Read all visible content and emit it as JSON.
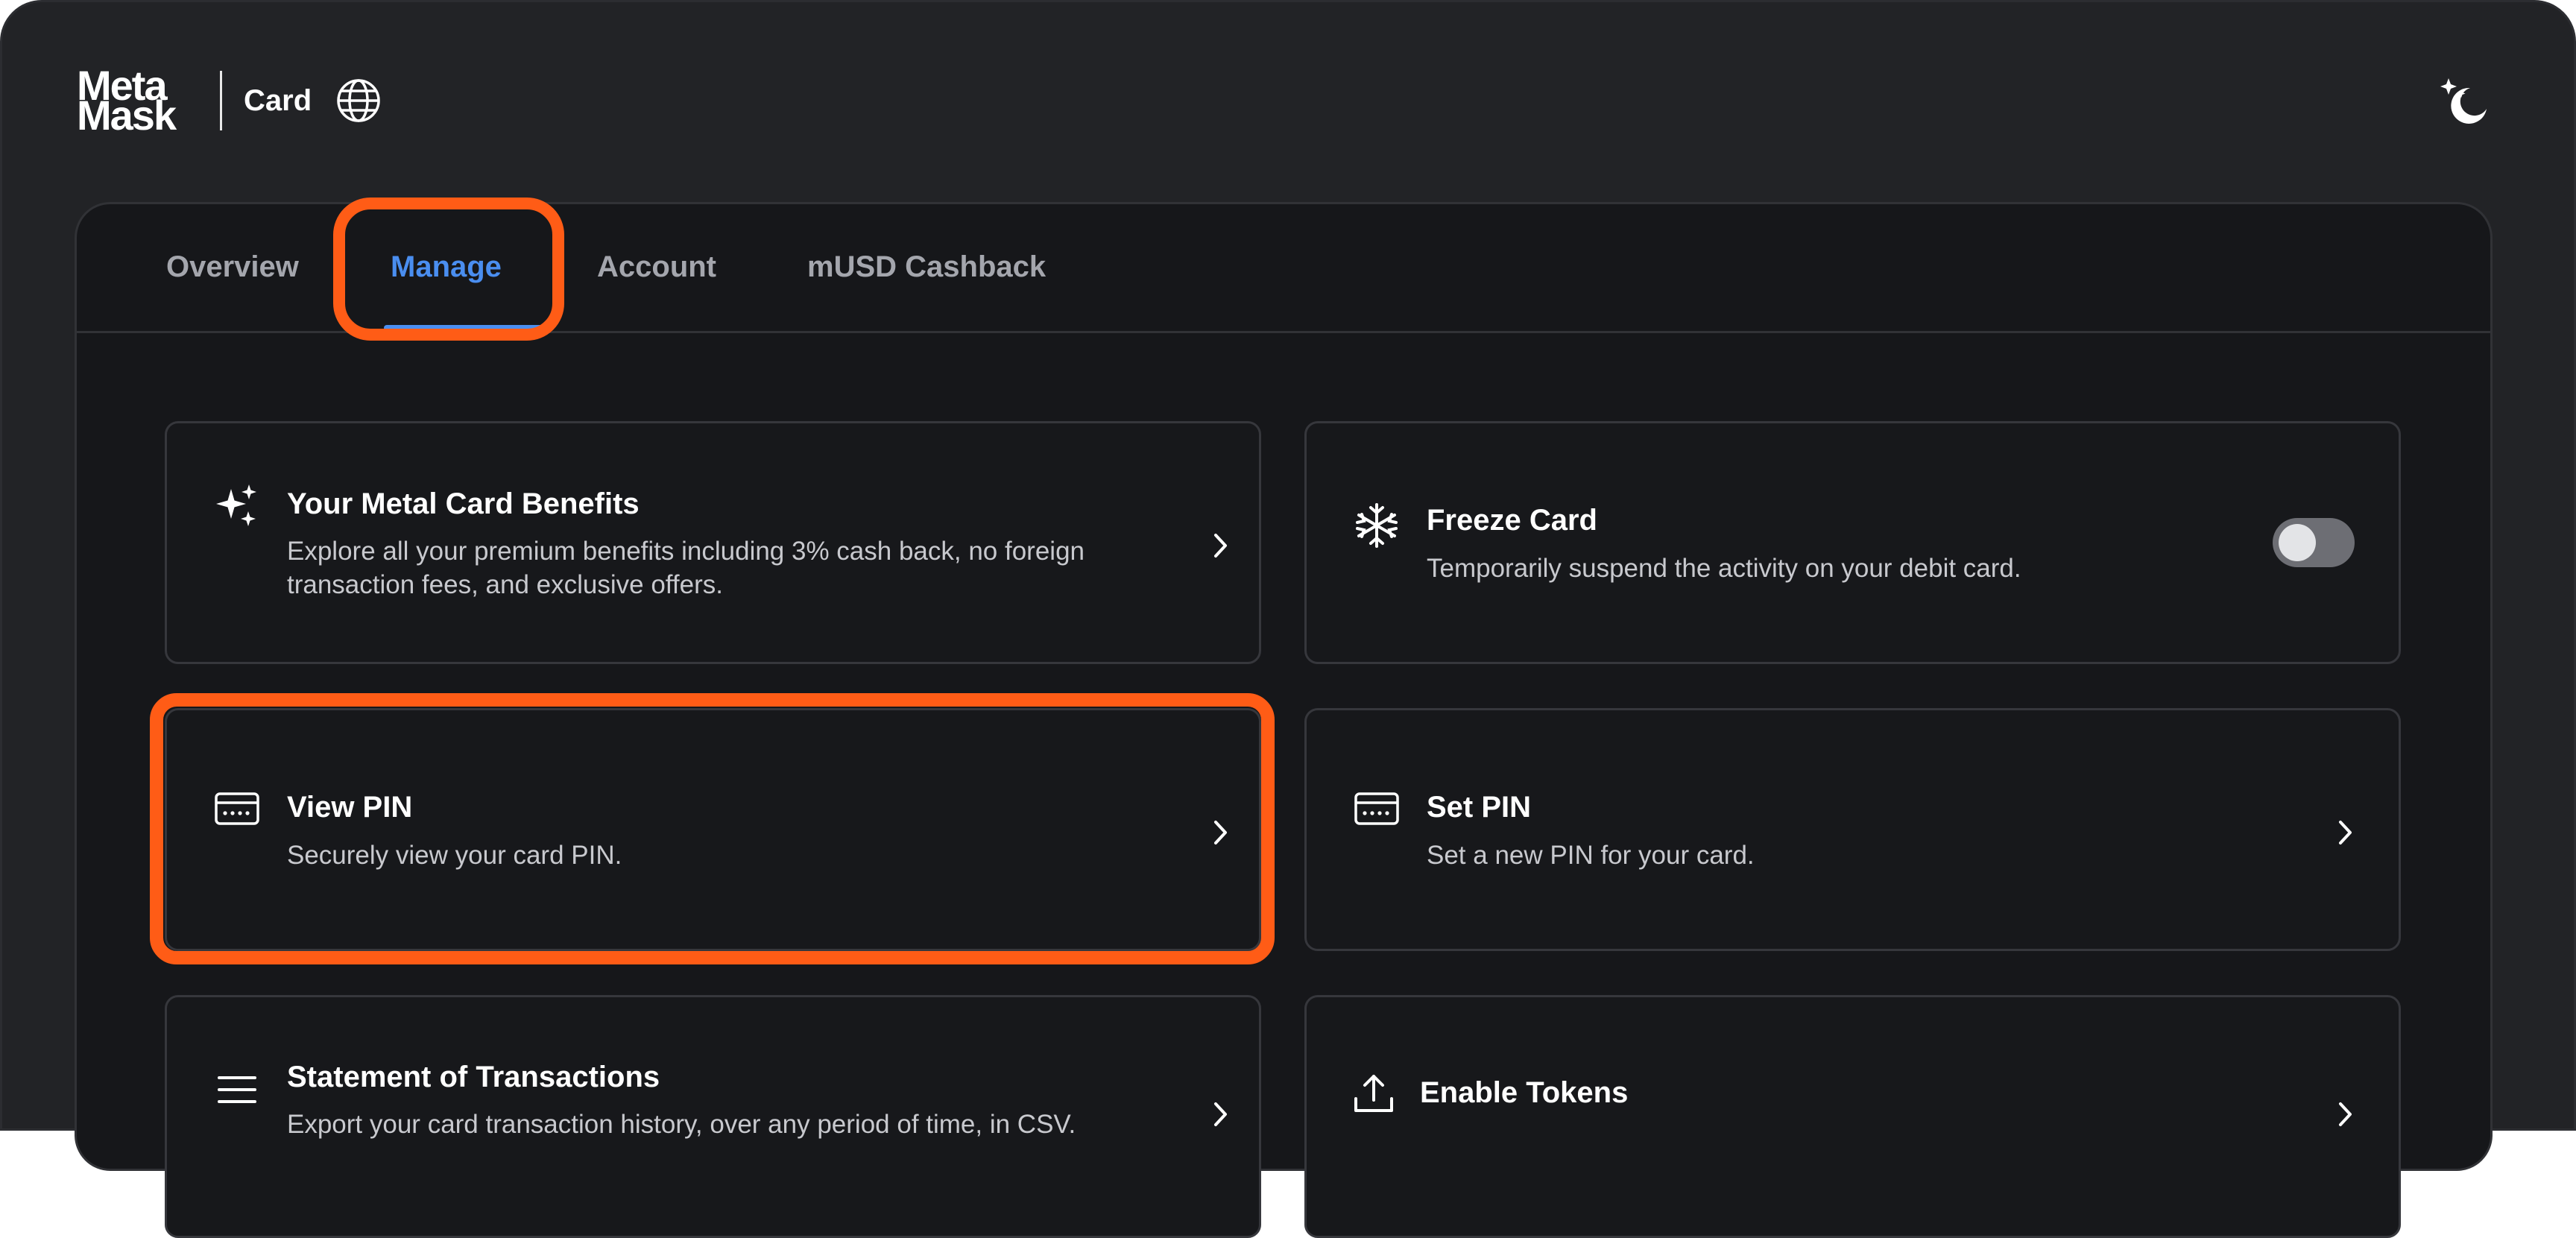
{
  "header": {
    "logo_line1": "Meta",
    "logo_line2": "Mask",
    "product": "Card",
    "icons": {
      "language": "globe-icon",
      "theme": "moon-stars-icon"
    }
  },
  "tabs": [
    {
      "label": "Overview",
      "active": false
    },
    {
      "label": "Manage",
      "active": true
    },
    {
      "label": "Account",
      "active": false
    },
    {
      "label": "mUSD Cashback",
      "active": false
    }
  ],
  "cards": {
    "benefits": {
      "icon": "sparkles-icon",
      "title": "Your Metal Card Benefits",
      "description": "Explore all your premium benefits including 3% cash back, no foreign transaction fees, and exclusive offers."
    },
    "freeze": {
      "icon": "snowflake-icon",
      "title": "Freeze Card",
      "description": "Temporarily suspend the activity on your debit card.",
      "toggle_on": false
    },
    "view_pin": {
      "icon": "card-pin-icon",
      "title": "View PIN",
      "description": "Securely view your card PIN."
    },
    "set_pin": {
      "icon": "card-pin-icon",
      "title": "Set PIN",
      "description": "Set a new PIN for your card."
    },
    "statement": {
      "icon": "list-icon",
      "title": "Statement of Transactions",
      "description": "Export your card transaction history, over any period of time, in CSV."
    },
    "tokens": {
      "icon": "upload-icon",
      "title": "Enable Tokens",
      "description": ""
    }
  },
  "colors": {
    "background": "#222326",
    "panel": "#16171a",
    "accent": "#4a8ef0",
    "highlight": "#ff5c16",
    "text": "#ffffff",
    "muted": "#c8c9ce"
  }
}
